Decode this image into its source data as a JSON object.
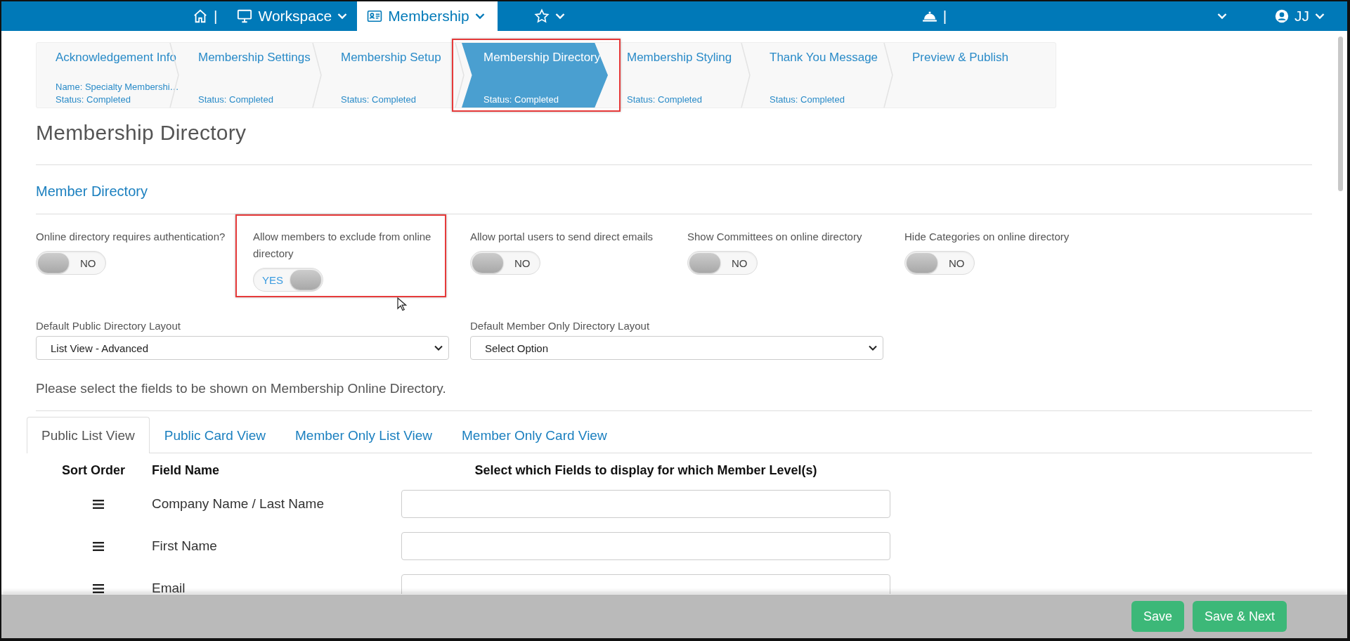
{
  "nav": [
    {
      "kind": "home",
      "label": "|",
      "selected": false
    },
    {
      "kind": "workspace",
      "label": "Workspace",
      "selected": false
    },
    {
      "kind": "membership",
      "label": "Membership",
      "selected": true
    },
    {
      "kind": "favorites",
      "selected": false
    },
    {
      "kind": "alerts",
      "label": "|",
      "selected": false
    },
    {
      "kind": "menu",
      "selected": false
    },
    {
      "kind": "user",
      "label": "JJ",
      "selected": false
    }
  ],
  "steps": [
    {
      "title": "Acknowledgement Info",
      "name": "Name: Specialty Membershi…",
      "status": "Status: Completed",
      "selected": false,
      "highlighted": false
    },
    {
      "title": "Membership Settings",
      "status": "Status: Completed",
      "selected": false,
      "highlighted": false
    },
    {
      "title": "Membership Setup",
      "status": "Status: Completed",
      "selected": false,
      "highlighted": false
    },
    {
      "title": "Membership Directory",
      "status": "Status: Completed",
      "selected": true,
      "highlighted": true
    },
    {
      "title": "Membership Styling",
      "status": "Status: Completed",
      "selected": false,
      "highlighted": false
    },
    {
      "title": "Thank You Message",
      "status": "Status: Completed",
      "selected": false,
      "highlighted": false
    },
    {
      "title": "Preview & Publish",
      "selected": false,
      "highlighted": false
    }
  ],
  "page_title": "Membership Directory",
  "section_title": "Member Directory",
  "toggles": [
    {
      "label": "Online directory requires authentication?",
      "on": false,
      "value_label": "NO",
      "highlighted": false
    },
    {
      "label": "Allow members to exclude from online directory",
      "on": true,
      "value_label": "YES",
      "highlighted": true
    },
    {
      "label": "Allow portal users to send direct emails",
      "on": false,
      "value_label": "NO",
      "highlighted": false
    },
    {
      "label": "Show Committees on online directory",
      "on": false,
      "value_label": "NO",
      "highlighted": false
    },
    {
      "label": "Hide Categories on online directory",
      "on": false,
      "value_label": "NO",
      "highlighted": false
    }
  ],
  "selects": [
    {
      "label": "Default Public Directory Layout",
      "value": "List View - Advanced"
    },
    {
      "label": "Default Member Only Directory Layout",
      "value": "Select Option"
    }
  ],
  "instructions": "Please select the fields to be shown on Membership Online Directory.",
  "tabs": [
    {
      "label": "Public List View",
      "selected": true
    },
    {
      "label": "Public Card View",
      "selected": false
    },
    {
      "label": "Member Only List View",
      "selected": false
    },
    {
      "label": "Member Only Card View",
      "selected": false
    }
  ],
  "table": {
    "columns": [
      "Sort Order",
      "Field Name",
      "Select which Fields to display for which Member Level(s)"
    ],
    "rows": [
      {
        "field": "Company Name / Last Name"
      },
      {
        "field": "First Name"
      },
      {
        "field": "Email"
      }
    ]
  },
  "buttons": [
    "Save",
    "Save & Next"
  ]
}
